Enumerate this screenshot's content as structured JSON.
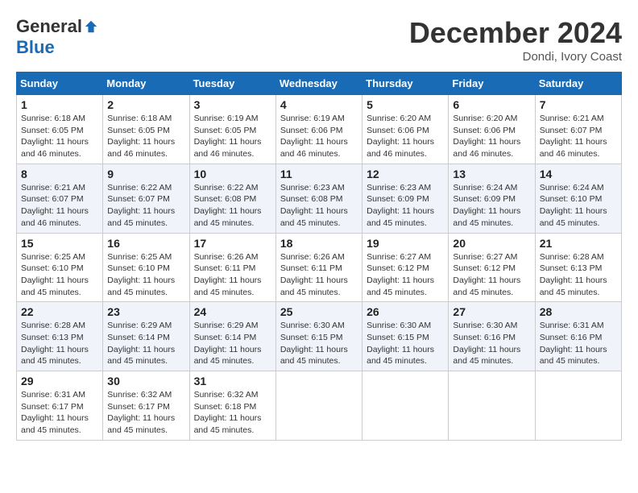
{
  "header": {
    "logo_general": "General",
    "logo_blue": "Blue",
    "month_title": "December 2024",
    "location": "Dondi, Ivory Coast"
  },
  "weekdays": [
    "Sunday",
    "Monday",
    "Tuesday",
    "Wednesday",
    "Thursday",
    "Friday",
    "Saturday"
  ],
  "weeks": [
    [
      {
        "day": "1",
        "sunrise": "6:18 AM",
        "sunset": "6:05 PM",
        "daylight": "11 hours and 46 minutes."
      },
      {
        "day": "2",
        "sunrise": "6:18 AM",
        "sunset": "6:05 PM",
        "daylight": "11 hours and 46 minutes."
      },
      {
        "day": "3",
        "sunrise": "6:19 AM",
        "sunset": "6:05 PM",
        "daylight": "11 hours and 46 minutes."
      },
      {
        "day": "4",
        "sunrise": "6:19 AM",
        "sunset": "6:06 PM",
        "daylight": "11 hours and 46 minutes."
      },
      {
        "day": "5",
        "sunrise": "6:20 AM",
        "sunset": "6:06 PM",
        "daylight": "11 hours and 46 minutes."
      },
      {
        "day": "6",
        "sunrise": "6:20 AM",
        "sunset": "6:06 PM",
        "daylight": "11 hours and 46 minutes."
      },
      {
        "day": "7",
        "sunrise": "6:21 AM",
        "sunset": "6:07 PM",
        "daylight": "11 hours and 46 minutes."
      }
    ],
    [
      {
        "day": "8",
        "sunrise": "6:21 AM",
        "sunset": "6:07 PM",
        "daylight": "11 hours and 46 minutes."
      },
      {
        "day": "9",
        "sunrise": "6:22 AM",
        "sunset": "6:07 PM",
        "daylight": "11 hours and 45 minutes."
      },
      {
        "day": "10",
        "sunrise": "6:22 AM",
        "sunset": "6:08 PM",
        "daylight": "11 hours and 45 minutes."
      },
      {
        "day": "11",
        "sunrise": "6:23 AM",
        "sunset": "6:08 PM",
        "daylight": "11 hours and 45 minutes."
      },
      {
        "day": "12",
        "sunrise": "6:23 AM",
        "sunset": "6:09 PM",
        "daylight": "11 hours and 45 minutes."
      },
      {
        "day": "13",
        "sunrise": "6:24 AM",
        "sunset": "6:09 PM",
        "daylight": "11 hours and 45 minutes."
      },
      {
        "day": "14",
        "sunrise": "6:24 AM",
        "sunset": "6:10 PM",
        "daylight": "11 hours and 45 minutes."
      }
    ],
    [
      {
        "day": "15",
        "sunrise": "6:25 AM",
        "sunset": "6:10 PM",
        "daylight": "11 hours and 45 minutes."
      },
      {
        "day": "16",
        "sunrise": "6:25 AM",
        "sunset": "6:10 PM",
        "daylight": "11 hours and 45 minutes."
      },
      {
        "day": "17",
        "sunrise": "6:26 AM",
        "sunset": "6:11 PM",
        "daylight": "11 hours and 45 minutes."
      },
      {
        "day": "18",
        "sunrise": "6:26 AM",
        "sunset": "6:11 PM",
        "daylight": "11 hours and 45 minutes."
      },
      {
        "day": "19",
        "sunrise": "6:27 AM",
        "sunset": "6:12 PM",
        "daylight": "11 hours and 45 minutes."
      },
      {
        "day": "20",
        "sunrise": "6:27 AM",
        "sunset": "6:12 PM",
        "daylight": "11 hours and 45 minutes."
      },
      {
        "day": "21",
        "sunrise": "6:28 AM",
        "sunset": "6:13 PM",
        "daylight": "11 hours and 45 minutes."
      }
    ],
    [
      {
        "day": "22",
        "sunrise": "6:28 AM",
        "sunset": "6:13 PM",
        "daylight": "11 hours and 45 minutes."
      },
      {
        "day": "23",
        "sunrise": "6:29 AM",
        "sunset": "6:14 PM",
        "daylight": "11 hours and 45 minutes."
      },
      {
        "day": "24",
        "sunrise": "6:29 AM",
        "sunset": "6:14 PM",
        "daylight": "11 hours and 45 minutes."
      },
      {
        "day": "25",
        "sunrise": "6:30 AM",
        "sunset": "6:15 PM",
        "daylight": "11 hours and 45 minutes."
      },
      {
        "day": "26",
        "sunrise": "6:30 AM",
        "sunset": "6:15 PM",
        "daylight": "11 hours and 45 minutes."
      },
      {
        "day": "27",
        "sunrise": "6:30 AM",
        "sunset": "6:16 PM",
        "daylight": "11 hours and 45 minutes."
      },
      {
        "day": "28",
        "sunrise": "6:31 AM",
        "sunset": "6:16 PM",
        "daylight": "11 hours and 45 minutes."
      }
    ],
    [
      {
        "day": "29",
        "sunrise": "6:31 AM",
        "sunset": "6:17 PM",
        "daylight": "11 hours and 45 minutes."
      },
      {
        "day": "30",
        "sunrise": "6:32 AM",
        "sunset": "6:17 PM",
        "daylight": "11 hours and 45 minutes."
      },
      {
        "day": "31",
        "sunrise": "6:32 AM",
        "sunset": "6:18 PM",
        "daylight": "11 hours and 45 minutes."
      },
      null,
      null,
      null,
      null
    ]
  ]
}
